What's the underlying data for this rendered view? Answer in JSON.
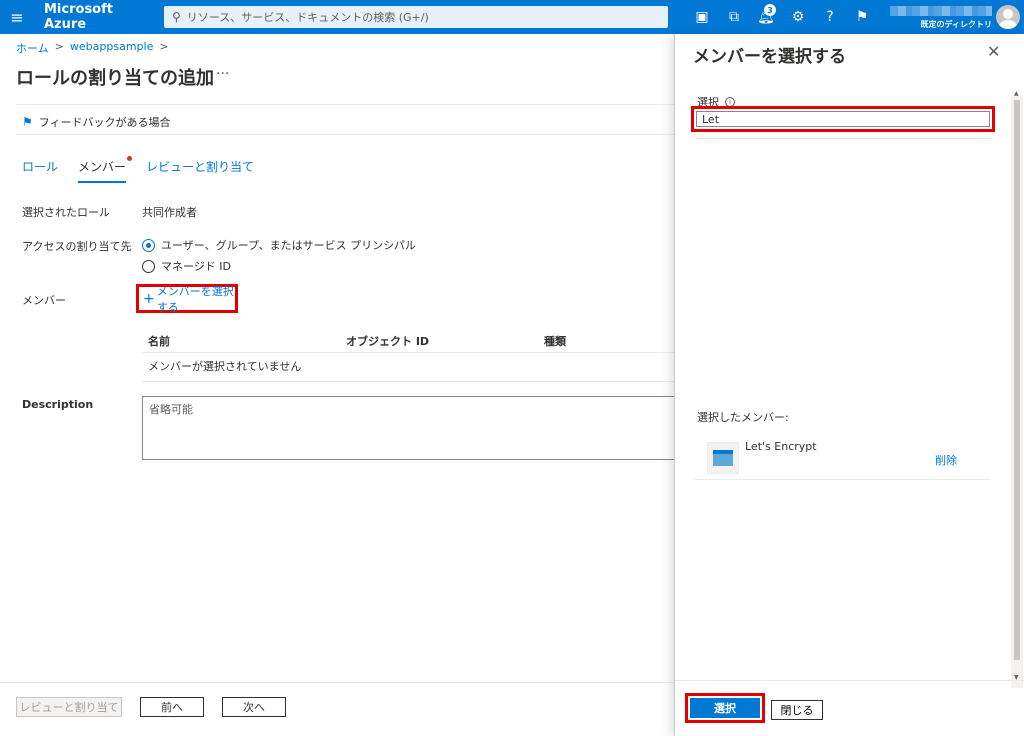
{
  "topbar": {
    "brand": "Microsoft Azure",
    "search_placeholder": "リソース、サービス、ドキュメントの検索 (G+/)",
    "notification_count": "3",
    "directory": "既定のディレクトリ"
  },
  "breadcrumb": {
    "home": "ホーム",
    "resource": "webappsample"
  },
  "page": {
    "title": "ロールの割り当ての追加",
    "more": "···",
    "feedback": "フィードバックがある場合"
  },
  "tabs": [
    {
      "label": "ロール"
    },
    {
      "label": "メンバー"
    },
    {
      "label": "レビューと割り当て"
    }
  ],
  "form": {
    "selected_role_label": "選択されたロール",
    "selected_role_value": "共同作成者",
    "assign_access_label": "アクセスの割り当て先",
    "option_user": "ユーザー、グループ、またはサービス プリンシパル",
    "option_managed": "マネージド ID",
    "members_label": "メンバー",
    "select_members_link": "メンバーを選択する",
    "table_headers": [
      "名前",
      "オブジェクト ID",
      "種類"
    ],
    "empty_text": "メンバーが選択されていません",
    "description_label": "Description",
    "description_placeholder": "省略可能"
  },
  "footer": {
    "review_assign": "レビューと割り当て",
    "prev": "前へ",
    "next": "次へ"
  },
  "panel": {
    "title": "メンバーを選択する",
    "select_label": "選択",
    "search_value": "Let",
    "selected_members_label": "選択したメンバー:",
    "member_name": "Let's Encrypt",
    "remove": "削除",
    "select_button": "選択",
    "close_button": "閉じる"
  },
  "colors": {
    "accent": "#0078d4",
    "highlight": "#e00000"
  }
}
